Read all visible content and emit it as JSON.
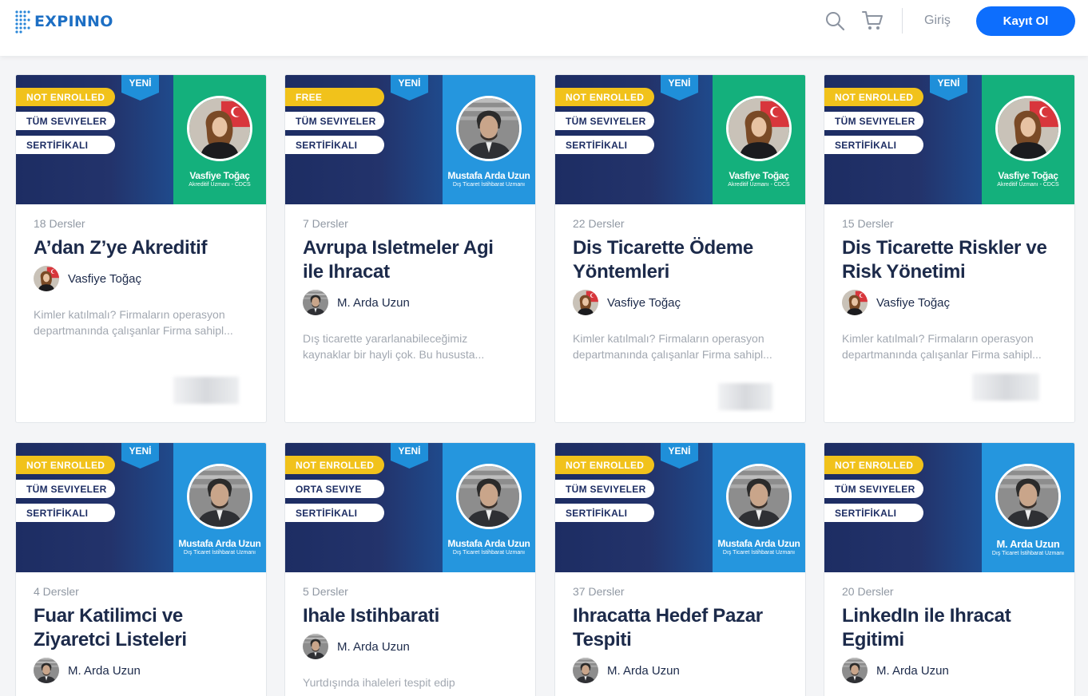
{
  "header": {
    "logo_text": "EXPINNO",
    "login_label": "Giriş",
    "register_label": "Kayıt Ol",
    "icons": [
      "search-icon",
      "cart-icon"
    ],
    "accent_color": "#0d6efd"
  },
  "courses": [
    {
      "status": "NOT ENROLLED",
      "level": "TÜM SEVIYELER",
      "cert": "SERTİFİKALI",
      "new_badge": "YENİ",
      "banner_name": "Vasfiye Toğaç",
      "banner_sub": "Akreditif Uzmanı - CDCS",
      "lessons": "18 Dersler",
      "title": "A’dan Z’ye Akreditif",
      "author": "Vasfiye Toğaç",
      "description": "Kimler katılmalı? Firmaların operasyon departmanında çalışanlar Firma sahipl..."
    },
    {
      "status": "FREE",
      "level": "TÜM SEVIYELER",
      "cert": "SERTİFİKALI",
      "new_badge": "YENİ",
      "banner_name": "Mustafa Arda Uzun",
      "banner_sub": "Dış Ticaret İstihbarat Uzmanı",
      "lessons": "7 Dersler",
      "title": "Avrupa Isletmeler Agi ile Ihracat",
      "author": "M. Arda Uzun",
      "description": "Dış ticarette yararlanabileceğimiz kaynaklar bir hayli çok. Bu hususta..."
    },
    {
      "status": "NOT ENROLLED",
      "level": "TÜM SEVIYELER",
      "cert": "SERTİFİKALI",
      "new_badge": "YENİ",
      "banner_name": "Vasfiye Toğaç",
      "banner_sub": "Akreditif Uzmanı - CDCS",
      "lessons": "22 Dersler",
      "title": "Dis Ticarette Ödeme Yöntemleri",
      "author": "Vasfiye Toğaç",
      "description": "Kimler katılmalı? Firmaların operasyon departmanında çalışanlar Firma sahipl..."
    },
    {
      "status": "NOT ENROLLED",
      "level": "TÜM SEVIYELER",
      "cert": "SERTİFİKALI",
      "new_badge": "YENİ",
      "banner_name": "Vasfiye Toğaç",
      "banner_sub": "Akreditif Uzmanı - CDCS",
      "lessons": "15 Dersler",
      "title": "Dis Ticarette Riskler ve Risk Yönetimi",
      "author": "Vasfiye Toğaç",
      "description": "Kimler katılmalı? Firmaların operasyon departmanında çalışanlar Firma sahipl..."
    },
    {
      "status": "NOT ENROLLED",
      "level": "TÜM SEVIYELER",
      "cert": "SERTİFİKALI",
      "new_badge": "YENİ",
      "banner_name": "Mustafa Arda Uzun",
      "banner_sub": "Dış Ticaret İstihbarat Uzmanı",
      "lessons": "4 Dersler",
      "title": "Fuar Katilimci ve Ziyaretci Listeleri",
      "author": "M. Arda Uzun",
      "description": ""
    },
    {
      "status": "NOT ENROLLED",
      "level": "ORTA SEVIYE",
      "cert": "SERTİFİKALI",
      "new_badge": "YENİ",
      "banner_name": "Mustafa Arda Uzun",
      "banner_sub": "Dış Ticaret İstihbarat Uzmanı",
      "lessons": "5 Dersler",
      "title": "Ihale Istihbarati",
      "author": "M. Arda Uzun",
      "description": "Yurtdışında ihaleleri tespit edip"
    },
    {
      "status": "NOT ENROLLED",
      "level": "TÜM SEVIYELER",
      "cert": "SERTİFİKALI",
      "new_badge": "YENİ",
      "banner_name": "Mustafa Arda Uzun",
      "banner_sub": "Dış Ticaret İstihbarat Uzmanı",
      "lessons": "37 Dersler",
      "title": "Ihracatta Hedef Pazar Tespiti",
      "author": "M. Arda Uzun",
      "description": ""
    },
    {
      "status": "NOT ENROLLED",
      "level": "TÜM SEVIYELER",
      "cert": "SERTİFİKALI",
      "new_badge": "",
      "banner_name": "M. Arda Uzun",
      "banner_sub": "Dış Ticaret İstihbarat Uzmanı",
      "lessons": "20 Dersler",
      "title": "LinkedIn ile Ihracat Egitimi",
      "author": "M. Arda Uzun",
      "description": ""
    }
  ]
}
